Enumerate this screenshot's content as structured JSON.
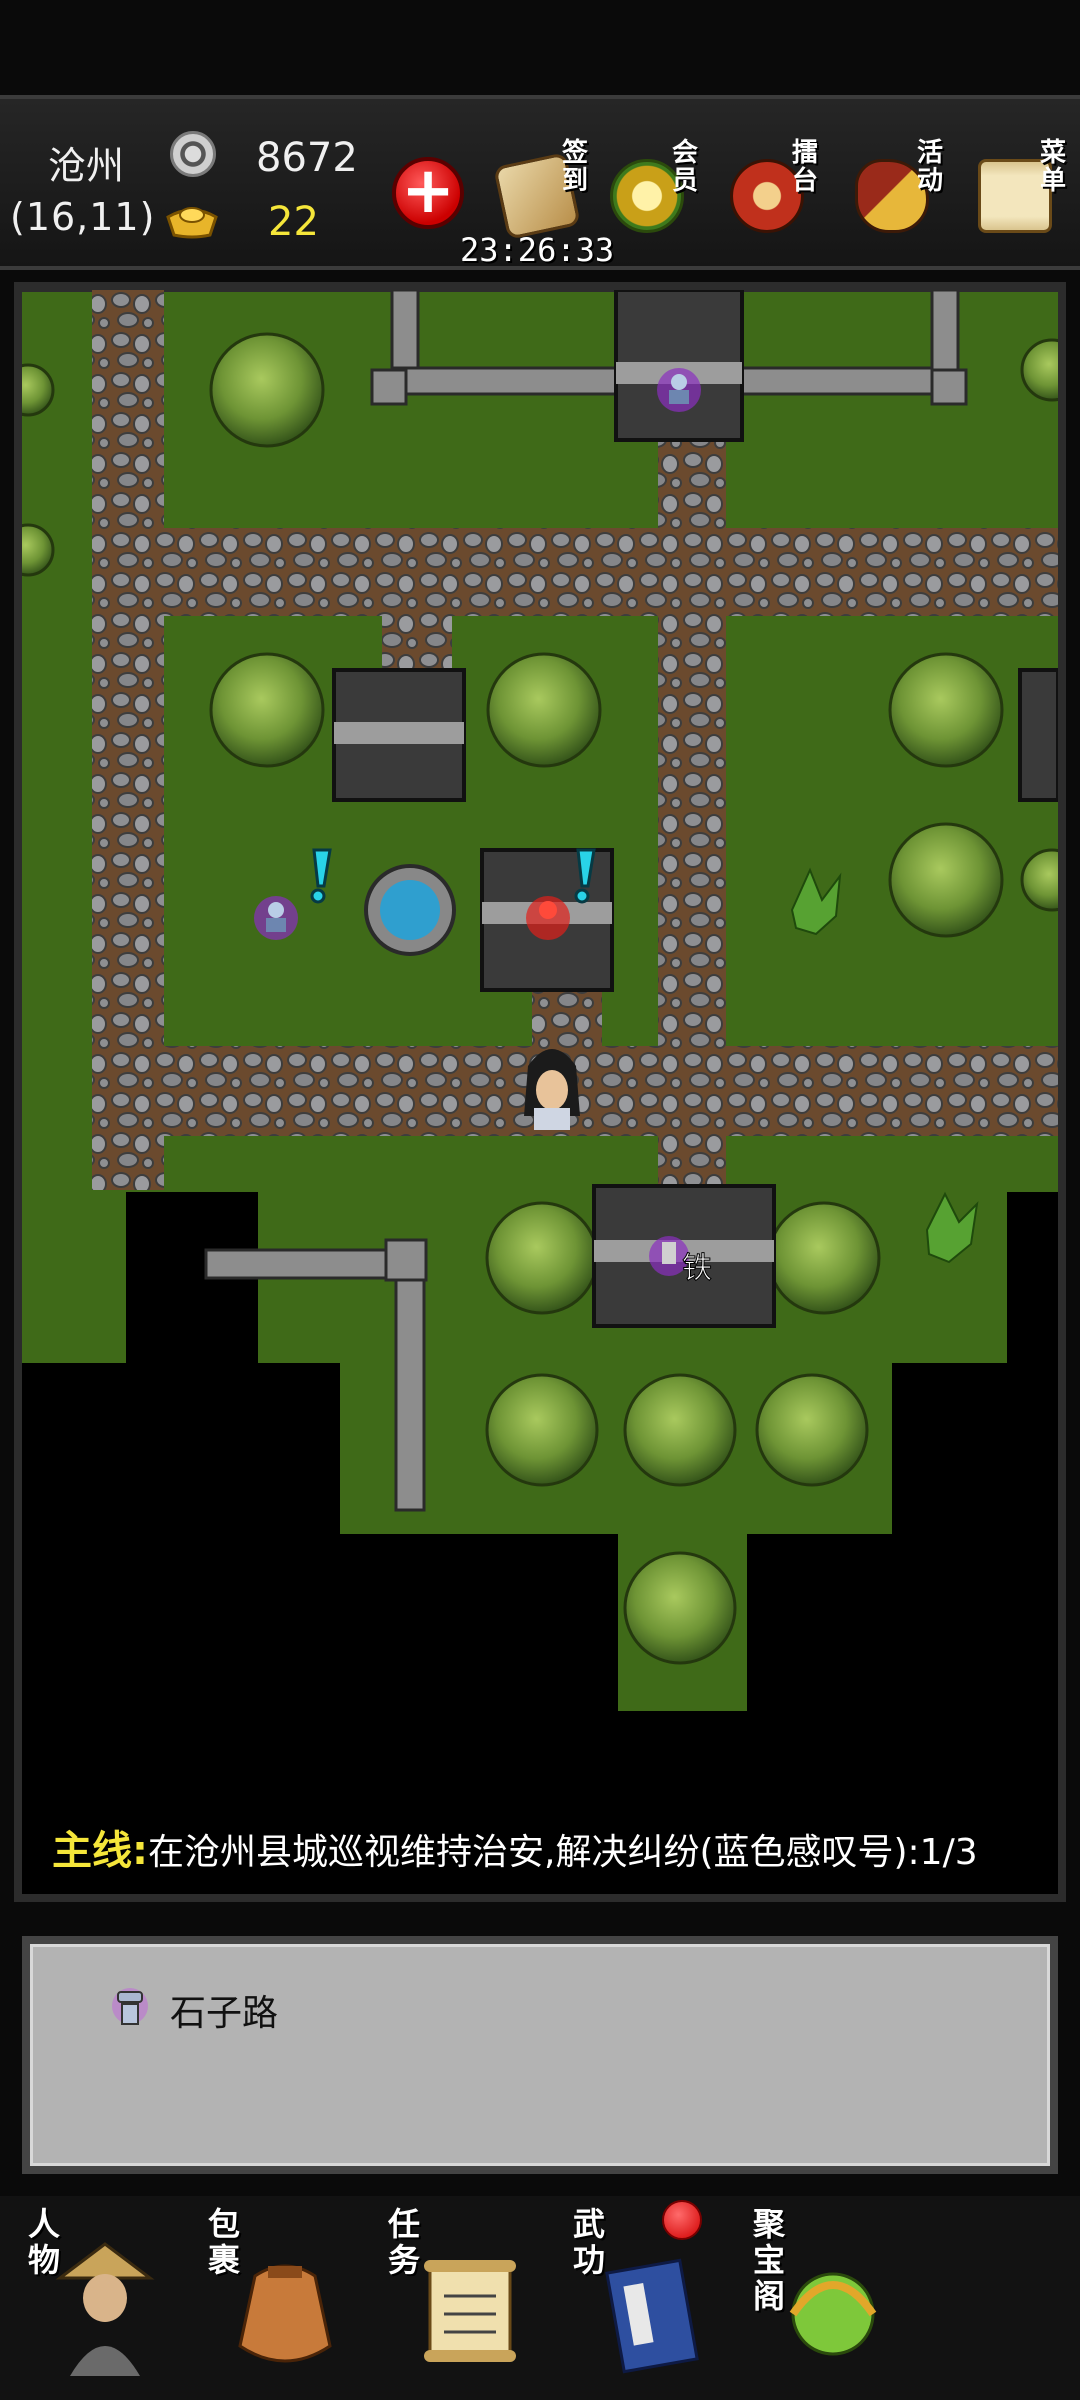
{
  "header": {
    "location_name": "沧州",
    "coordinates": "(16,11)",
    "silver_amount": "8672",
    "gold_amount": "22",
    "silver_icon": "silver-coin-icon",
    "gold_icon": "gold-ingot-icon",
    "add_icon": "plus-icon",
    "timer": "23:26:33",
    "buttons": [
      {
        "label": "签到",
        "icon": "scroll-brush-icon"
      },
      {
        "label": "会员",
        "icon": "gold-medal-icon"
      },
      {
        "label": "擂台",
        "icon": "war-drum-icon"
      },
      {
        "label": "活动",
        "icon": "gourd-fan-icon"
      },
      {
        "label": "菜单",
        "icon": "scroll-menu-icon"
      }
    ]
  },
  "map": {
    "marker_label": "铁",
    "quest": {
      "prefix": "主线",
      "separator": ":",
      "text": "在沧州县城巡视维持治安,解决纠纷(蓝色感叹号):1/3"
    }
  },
  "info_panel": {
    "icon": "stone-path-icon",
    "text": "石子路"
  },
  "bottom_nav": {
    "items": [
      {
        "label": "人物",
        "icon": "character-icon"
      },
      {
        "label": "包裹",
        "icon": "bag-icon"
      },
      {
        "label": "任务",
        "icon": "quest-scroll-icon"
      },
      {
        "label": "武功",
        "icon": "martial-book-icon"
      },
      {
        "label": "聚宝阁",
        "icon": "treasure-icon"
      }
    ]
  },
  "colors": {
    "grass": "#3f6a18",
    "path": "#6b4a2e",
    "quest_tag": "#f5e63a",
    "quest_mark": "#29d3e8",
    "panel_bg": "#b3b3b3"
  }
}
